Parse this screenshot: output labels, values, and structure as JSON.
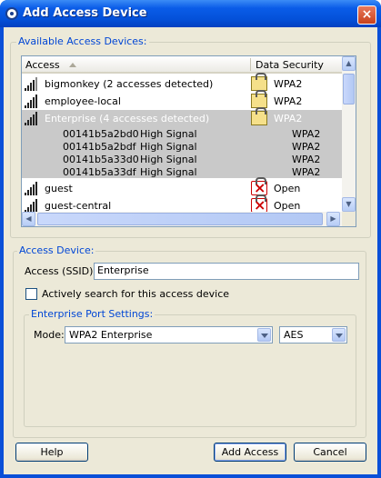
{
  "window": {
    "title": "Add Access Device",
    "close_glyph": "×"
  },
  "available": {
    "group_label": "Available Access Devices:",
    "columns": {
      "access": "Access",
      "security": "Data Security"
    },
    "rows": [
      {
        "name": "bigmonkey (2 accesses detected)",
        "security": "WPA2",
        "lock": "locked"
      },
      {
        "name": "employee-local",
        "security": "WPA2",
        "lock": "locked"
      },
      {
        "name": "Enterprise (4 accesses detected)",
        "security": "WPA2",
        "lock": "locked",
        "selected": true
      },
      {
        "name": "guest",
        "security": "Open",
        "lock": "open"
      },
      {
        "name": "guest-central",
        "security": "Open",
        "lock": "open"
      }
    ],
    "sub_rows": [
      {
        "mac": "00141b5a2bd0",
        "signal": "High Signal",
        "security": "WPA2"
      },
      {
        "mac": "00141b5a2bdf",
        "signal": "High Signal",
        "security": "WPA2"
      },
      {
        "mac": "00141b5a33d0",
        "signal": "High Signal",
        "security": "WPA2"
      },
      {
        "mac": "00141b5a33df",
        "signal": "High Signal",
        "security": "WPA2"
      }
    ]
  },
  "access_device": {
    "group_label": "Access Device:",
    "ssid_label": "Access (SSID):",
    "ssid_value": "Enterprise",
    "active_search_label": "Actively search for this access device",
    "active_search_checked": false
  },
  "enterprise": {
    "group_label": "Enterprise Port Settings:",
    "mode_label": "Mode:",
    "mode_value": "WPA2 Enterprise",
    "cipher_value": "AES"
  },
  "buttons": {
    "help": "Help",
    "add": "Add Access",
    "cancel": "Cancel"
  },
  "colors": {
    "title_blue": "#0451d9",
    "group_label": "#0046d5",
    "selected_row": "#c9c9c9"
  }
}
